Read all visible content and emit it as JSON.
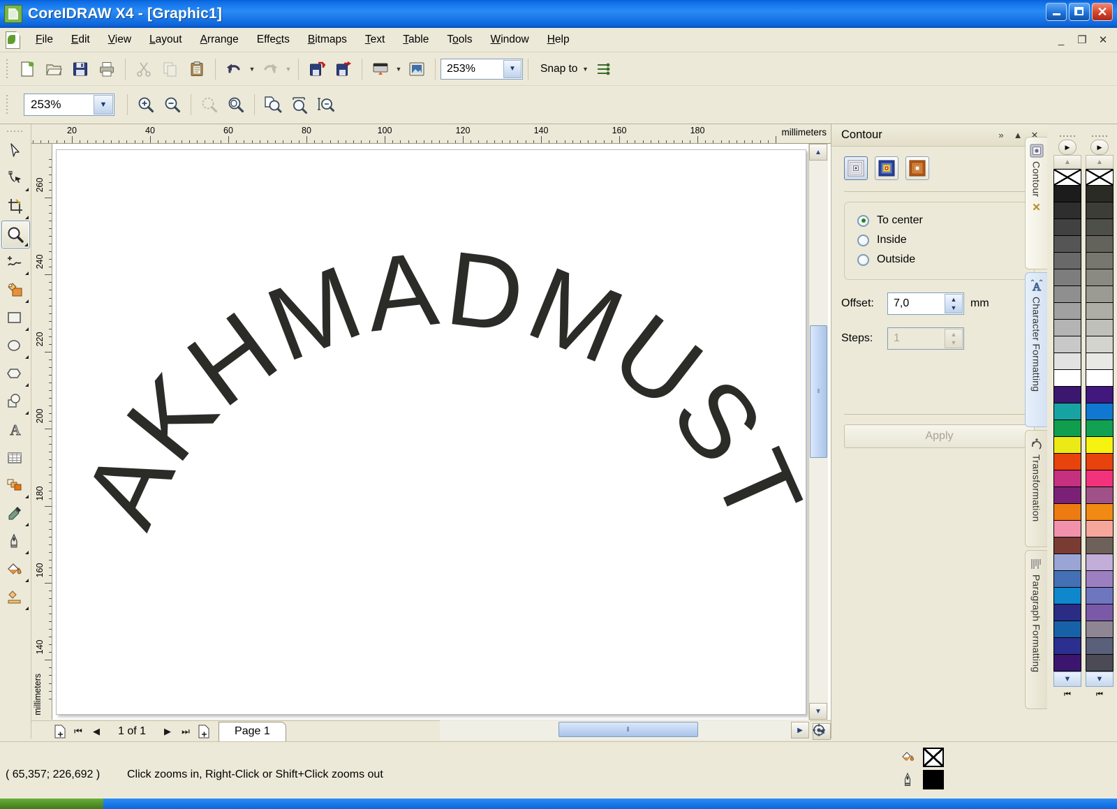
{
  "window": {
    "title": "CoreIDRAW X4 - [Graphic1]",
    "app_icon": "corel-logo-icon",
    "minimize": "_",
    "maximize": "❐",
    "close": "✕",
    "mdi_minimize": "_",
    "mdi_restore": "❐",
    "mdi_close": "✕"
  },
  "menu": {
    "items": [
      {
        "label": "File",
        "accel": "F"
      },
      {
        "label": "Edit",
        "accel": "E"
      },
      {
        "label": "View",
        "accel": "V"
      },
      {
        "label": "Layout",
        "accel": "L"
      },
      {
        "label": "Arrange",
        "accel": "A"
      },
      {
        "label": "Effects",
        "accel": "c"
      },
      {
        "label": "Bitmaps",
        "accel": "B"
      },
      {
        "label": "Text",
        "accel": "T"
      },
      {
        "label": "Table",
        "accel": "T"
      },
      {
        "label": "Tools",
        "accel": "o"
      },
      {
        "label": "Window",
        "accel": "W"
      },
      {
        "label": "Help",
        "accel": "H"
      }
    ]
  },
  "standard_toolbar": {
    "buttons": [
      {
        "name": "new-document-icon",
        "disabled": false
      },
      {
        "name": "open-document-icon",
        "disabled": false
      },
      {
        "name": "save-icon",
        "disabled": false
      },
      {
        "name": "print-icon",
        "disabled": false
      },
      {
        "name": "cut-icon",
        "disabled": true
      },
      {
        "name": "copy-icon",
        "disabled": true
      },
      {
        "name": "paste-icon",
        "disabled": false
      },
      {
        "name": "undo-icon",
        "disabled": false
      },
      {
        "name": "redo-icon",
        "disabled": true
      },
      {
        "name": "import-icon",
        "disabled": false
      },
      {
        "name": "export-icon",
        "disabled": false
      },
      {
        "name": "application-launcher-icon",
        "disabled": false
      },
      {
        "name": "corel-connect-icon",
        "disabled": false
      }
    ],
    "zoom_value": "253%",
    "snap_to_label": "Snap to",
    "options_icon": "options-icon"
  },
  "zoom_toolbar": {
    "zoom_value": "253%",
    "buttons": [
      {
        "name": "zoom-in-icon",
        "disabled": false
      },
      {
        "name": "zoom-out-icon",
        "disabled": false
      },
      {
        "name": "zoom-to-selection-icon",
        "disabled": true
      },
      {
        "name": "zoom-to-all-objects-icon",
        "disabled": false
      },
      {
        "name": "zoom-to-page-icon",
        "disabled": false
      },
      {
        "name": "zoom-to-page-width-icon",
        "disabled": false
      },
      {
        "name": "zoom-to-page-height-icon",
        "disabled": false
      }
    ]
  },
  "toolbox": {
    "tools": [
      {
        "name": "pick-tool",
        "glyph": "pick",
        "selected": false,
        "flyout": false
      },
      {
        "name": "shape-tool",
        "glyph": "shape",
        "selected": false,
        "flyout": true
      },
      {
        "name": "crop-tool",
        "glyph": "crop",
        "selected": false,
        "flyout": true
      },
      {
        "name": "zoom-tool",
        "glyph": "zoom",
        "selected": true,
        "flyout": true
      },
      {
        "name": "freehand-tool",
        "glyph": "freehand",
        "selected": false,
        "flyout": true
      },
      {
        "name": "smart-fill-tool",
        "glyph": "smartfill",
        "selected": false,
        "flyout": true
      },
      {
        "name": "rectangle-tool",
        "glyph": "rectangle",
        "selected": false,
        "flyout": true
      },
      {
        "name": "ellipse-tool",
        "glyph": "ellipse",
        "selected": false,
        "flyout": true
      },
      {
        "name": "polygon-tool",
        "glyph": "polygon",
        "selected": false,
        "flyout": true
      },
      {
        "name": "basic-shapes-tool",
        "glyph": "shapes",
        "selected": false,
        "flyout": true
      },
      {
        "name": "text-tool",
        "glyph": "text",
        "selected": false,
        "flyout": false
      },
      {
        "name": "table-tool",
        "glyph": "table",
        "selected": false,
        "flyout": false
      },
      {
        "name": "blend-tool",
        "glyph": "blend",
        "selected": false,
        "flyout": true
      },
      {
        "name": "eyedropper-tool",
        "glyph": "eyedropper",
        "selected": false,
        "flyout": true
      },
      {
        "name": "outline-tool",
        "glyph": "outline",
        "selected": false,
        "flyout": true
      },
      {
        "name": "fill-tool",
        "glyph": "fill",
        "selected": false,
        "flyout": true
      },
      {
        "name": "interactive-fill-tool",
        "glyph": "interactivefill",
        "selected": false,
        "flyout": true
      }
    ]
  },
  "rulers": {
    "unit_label": "millimeters",
    "vertical_unit_label": "millimeters",
    "horizontal_ticks": [
      20,
      40,
      60,
      80,
      100,
      120,
      140,
      160,
      180
    ],
    "vertical_ticks": [
      260,
      240,
      220,
      200,
      180,
      160,
      140
    ]
  },
  "canvas": {
    "artwork_text": "AKHMADMUST",
    "artwork_color": "#2b2b28"
  },
  "page_nav": {
    "add_page_start_icon": "add-page-icon",
    "first_icon": "⏮",
    "prev_icon": "◀",
    "counter": "1 of 1",
    "next_icon": "▶",
    "last_icon": "⏭",
    "add_page_end_icon": "add-page-icon",
    "tab_label": "Page 1"
  },
  "docker": {
    "title": "Contour",
    "collapse_icon": "»",
    "roll_up_icon": "▲",
    "close_icon": "✕",
    "presets": [
      {
        "name": "contour-to-center-preset",
        "selected": true
      },
      {
        "name": "contour-inside-preset",
        "selected": false
      },
      {
        "name": "contour-outside-preset",
        "selected": false
      }
    ],
    "direction_options": [
      {
        "label": "To center",
        "selected": true
      },
      {
        "label": "Inside",
        "selected": false
      },
      {
        "label": "Outside",
        "selected": false
      }
    ],
    "offset": {
      "label": "Offset:",
      "value": "7,0",
      "unit": "mm",
      "disabled": false
    },
    "steps": {
      "label": "Steps:",
      "value": "1",
      "disabled": true
    },
    "apply_label": "Apply",
    "apply_disabled": true
  },
  "side_tabs": [
    {
      "label": "Contour",
      "icon": "contour-icon",
      "active": true,
      "has_close": true,
      "close_icon": "✕"
    },
    {
      "label": "Character Formatting",
      "icon": "character-formatting-icon",
      "active": false,
      "has_close": false
    },
    {
      "label": "Transformation",
      "icon": "transformation-icon",
      "active": false,
      "has_close": false
    },
    {
      "label": "Paragraph Formatting",
      "icon": "paragraph-formatting-icon",
      "active": false,
      "has_close": false
    }
  ],
  "palette": {
    "scroll_up_icon": "▲",
    "scroll_down_icon": "▼",
    "end_icon": "⏮",
    "column_a": [
      "none",
      "#1c1c1c",
      "#2e2e2e",
      "#414141",
      "#555555",
      "#696969",
      "#7d7d7d",
      "#8f8f8f",
      "#a1a1a1",
      "#b4b4b4",
      "#c8c8c8",
      "#e2e2e2",
      "#ffffff",
      "#3b1770",
      "#18a3a3",
      "#0f9e4e",
      "#ecea16",
      "#e8430c",
      "#c5307f",
      "#7a2177",
      "#ee7b11",
      "#f291ab",
      "#7a3b33",
      "#9aa5d6",
      "#4470b5",
      "#0e87cd",
      "#2a2c85",
      "#1761a8",
      "#2b2f8f",
      "#3c166e"
    ],
    "column_b": [
      "none",
      "#2b2b26",
      "#3d3d37",
      "#4f4f49",
      "#63635c",
      "#77776f",
      "#8a8a82",
      "#9b9b94",
      "#aeaea7",
      "#c0c0ba",
      "#d4d4cf",
      "#e8e8e4",
      "#ffffff",
      "#42177e",
      "#1078d0",
      "#12a052",
      "#f5f30f",
      "#e8430c",
      "#f2337c",
      "#a05188",
      "#f08a13",
      "#f7a69c",
      "#6d6159",
      "#c2aed8",
      "#9b7fc0",
      "#6f76c0",
      "#7a5aa8",
      "#8f8694",
      "#5a5f7a",
      "#4c4a55"
    ]
  },
  "status_bar": {
    "coordinates": "( 65,357; 226,692 )",
    "hint": "Click zooms in, Right-Click or Shift+Click zooms out",
    "fill_icon": "fill-bucket-icon",
    "fill_value": "none",
    "outline_icon": "outline-pen-icon",
    "outline_value": "#000000"
  }
}
